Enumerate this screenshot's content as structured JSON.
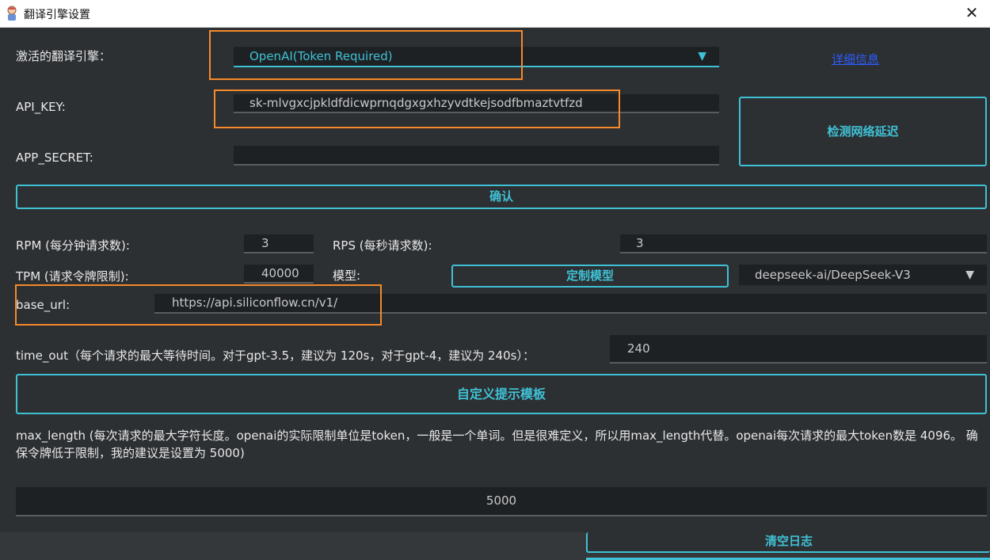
{
  "window": {
    "title": "翻译引擎设置",
    "close_glyph": "✕"
  },
  "engine": {
    "label": "激活的翻译引擎：",
    "selected": "OpenAI(Token Required)",
    "details_link": "详细信息"
  },
  "api_key": {
    "label": "API_KEY:",
    "value": "sk-mlvgxcjpkldfdicwprnqdgxgxhzyvdtkejsodfbmaztvtfzd"
  },
  "app_secret": {
    "label": "APP_SECRET:",
    "value": ""
  },
  "buttons": {
    "latency": "检测网络延迟",
    "confirm": "确认",
    "custom_model": "定制模型",
    "prompt_template": "自定义提示模板",
    "clear_log": "清空日志"
  },
  "rpm": {
    "label": "RPM (每分钟请求数):",
    "value": "3"
  },
  "rps": {
    "label": "RPS (每秒请求数):",
    "value": "3"
  },
  "tpm": {
    "label": "TPM (请求令牌限制):",
    "value": "40000"
  },
  "model": {
    "label": "模型:",
    "selected": "deepseek-ai/DeepSeek-V3"
  },
  "base_url": {
    "label": "base_url:",
    "value": "https://api.siliconflow.cn/v1/"
  },
  "time_out": {
    "label": "time_out（每个请求的最大等待时间。对于gpt-3.5，建议为 120s，对于gpt-4，建议为 240s）：",
    "value": "240"
  },
  "max_length": {
    "description": "max_length (每次请求的最大字符长度。openai的实际限制单位是token，一般是一个单词。但是很难定义，所以用max_length代替。openai每次请求的最大token数是 4096。 确保令牌低于限制，我的建议是设置为 5000)",
    "value": "5000"
  },
  "icons": {
    "app": "app-icon",
    "close": "close-icon",
    "dropdown": "chevron-down-icon"
  },
  "colors": {
    "accent": "#3fc1d5",
    "highlight": "#f5892b",
    "background": "#2d3033",
    "field": "#1e2124",
    "link": "#2b5cff"
  }
}
